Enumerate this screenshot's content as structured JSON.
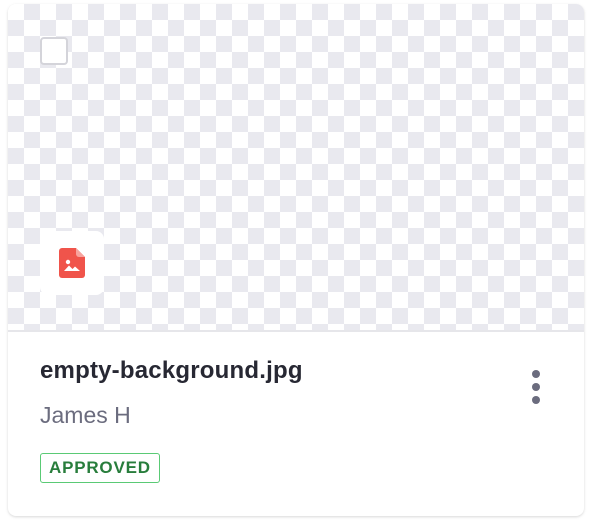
{
  "card": {
    "file_name": "empty-background.jpg",
    "author": "James H",
    "status": "APPROVED",
    "file_type_icon": "image-file-icon",
    "actions_icon": "ellipsis-vertical-icon",
    "checkbox_checked": false
  },
  "colors": {
    "file_icon": "#f0544b",
    "status_text": "#287d3c",
    "status_border": "#5aca75",
    "title_text": "#272833",
    "secondary_text": "#6b6c7e",
    "checker_light": "#ffffff",
    "checker_dark": "#e9e9ef"
  }
}
